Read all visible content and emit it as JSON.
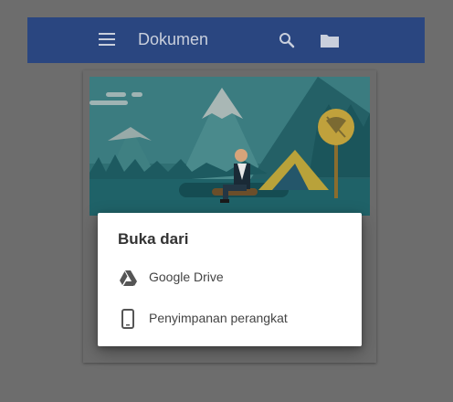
{
  "appbar": {
    "title": "Dokumen",
    "icons": [
      "menu-icon",
      "search-icon",
      "folder-icon"
    ],
    "color": "#2a4680"
  },
  "dialog": {
    "title": "Buka dari",
    "options": [
      {
        "label": "Google Drive",
        "icon": "google-drive-icon"
      },
      {
        "label": "Penyimpanan perangkat",
        "icon": "phone-icon"
      }
    ]
  },
  "colors": {
    "scrim": "#6d6d6d",
    "accent_tent": "#b9a23a",
    "scene_teal": "#1e5f66"
  }
}
